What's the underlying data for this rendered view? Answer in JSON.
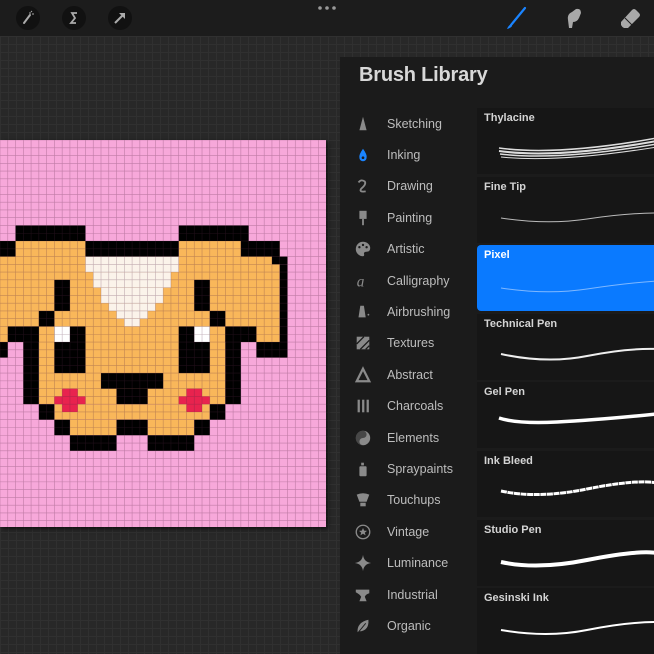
{
  "toolbar": {
    "left_tools": [
      "magic-wand-icon",
      "selection-s-icon",
      "transform-arrow-icon"
    ],
    "more_icon": "ellipsis-icon",
    "right_tools": [
      {
        "icon": "brush-icon",
        "active": true
      },
      {
        "icon": "smudge-icon",
        "active": false
      },
      {
        "icon": "eraser-icon",
        "active": false
      }
    ],
    "accent_color": "#0a7aff"
  },
  "canvas": {
    "background_color": "#f7a8da",
    "description_colors": {
      "fur": "#f9b75a",
      "outline": "#000000",
      "muzzle": "#fbf3ea",
      "cheek": "#e8234e"
    }
  },
  "brush_library": {
    "title": "Brush Library",
    "categories": [
      {
        "label": "Sketching",
        "icon": "pencil-tip-icon"
      },
      {
        "label": "Inking",
        "icon": "ink-drop-icon",
        "selected": true
      },
      {
        "label": "Drawing",
        "icon": "squiggle-icon"
      },
      {
        "label": "Painting",
        "icon": "paintbrush-icon"
      },
      {
        "label": "Artistic",
        "icon": "palette-icon"
      },
      {
        "label": "Calligraphy",
        "icon": "calligraphy-a-icon"
      },
      {
        "label": "Airbrushing",
        "icon": "airbrush-icon"
      },
      {
        "label": "Textures",
        "icon": "texture-icon"
      },
      {
        "label": "Abstract",
        "icon": "triangle-icon"
      },
      {
        "label": "Charcoals",
        "icon": "charcoal-sticks-icon"
      },
      {
        "label": "Elements",
        "icon": "yin-yang-icon"
      },
      {
        "label": "Spraypaints",
        "icon": "spray-can-icon"
      },
      {
        "label": "Touchups",
        "icon": "touchup-brush-icon"
      },
      {
        "label": "Vintage",
        "icon": "star-circle-icon"
      },
      {
        "label": "Luminance",
        "icon": "sparkle-icon"
      },
      {
        "label": "Industrial",
        "icon": "anvil-icon"
      },
      {
        "label": "Organic",
        "icon": "leaf-icon"
      }
    ],
    "brushes": [
      {
        "name": "Thylacine"
      },
      {
        "name": "Fine Tip"
      },
      {
        "name": "Pixel",
        "selected": true
      },
      {
        "name": "Technical Pen"
      },
      {
        "name": "Gel Pen"
      },
      {
        "name": "Ink Bleed"
      },
      {
        "name": "Studio Pen"
      },
      {
        "name": "Gesinski Ink"
      }
    ]
  }
}
